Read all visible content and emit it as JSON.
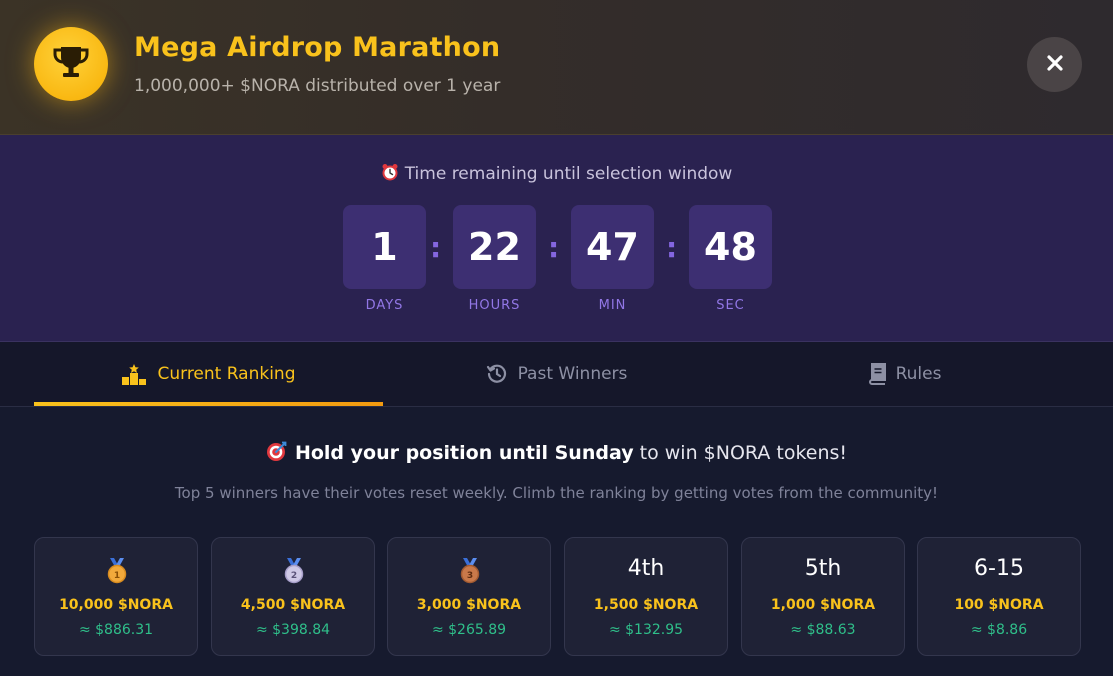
{
  "header": {
    "title": "Mega Airdrop Marathon",
    "subtitle": "1,000,000+ $NORA distributed over 1 year",
    "icon": "trophy-icon",
    "close_icon": "close-icon"
  },
  "countdown": {
    "label": "Time remaining until selection window",
    "label_icon": "alarm-clock-icon",
    "units": [
      {
        "value": "1",
        "label": "DAYS"
      },
      {
        "value": "22",
        "label": "HOURS"
      },
      {
        "value": "47",
        "label": "MIN"
      },
      {
        "value": "48",
        "label": "SEC"
      }
    ],
    "separator": ":"
  },
  "tabs": [
    {
      "label": "Current Ranking",
      "icon": "podium-icon",
      "active": true
    },
    {
      "label": "Past Winners",
      "icon": "history-icon",
      "active": false
    },
    {
      "label": "Rules",
      "icon": "book-icon",
      "active": false
    }
  ],
  "main": {
    "headline_bold": "Hold your position until Sunday",
    "headline_rest": " to win $NORA tokens!",
    "headline_icon": "target-icon",
    "subline": "Top 5 winners have their votes reset weekly. Climb the ranking by getting votes from the community!"
  },
  "prizes": [
    {
      "rank": "",
      "medal": "gold-medal-icon",
      "amount": "10,000 $NORA",
      "usd": "≈ $886.31"
    },
    {
      "rank": "",
      "medal": "silver-medal-icon",
      "amount": "4,500 $NORA",
      "usd": "≈ $398.84"
    },
    {
      "rank": "",
      "medal": "bronze-medal-icon",
      "amount": "3,000 $NORA",
      "usd": "≈ $265.89"
    },
    {
      "rank": "4th",
      "medal": "",
      "amount": "1,500 $NORA",
      "usd": "≈ $132.95"
    },
    {
      "rank": "5th",
      "medal": "",
      "amount": "1,000 $NORA",
      "usd": "≈ $88.63"
    },
    {
      "rank": "6-15",
      "medal": "",
      "amount": "100 $NORA",
      "usd": "≈ $8.86"
    }
  ],
  "colors": {
    "accent": "#f9c21c",
    "countdown_bg": "#2a2250",
    "countdown_box": "#3d2f72",
    "usd_green": "#2fbf8a"
  }
}
